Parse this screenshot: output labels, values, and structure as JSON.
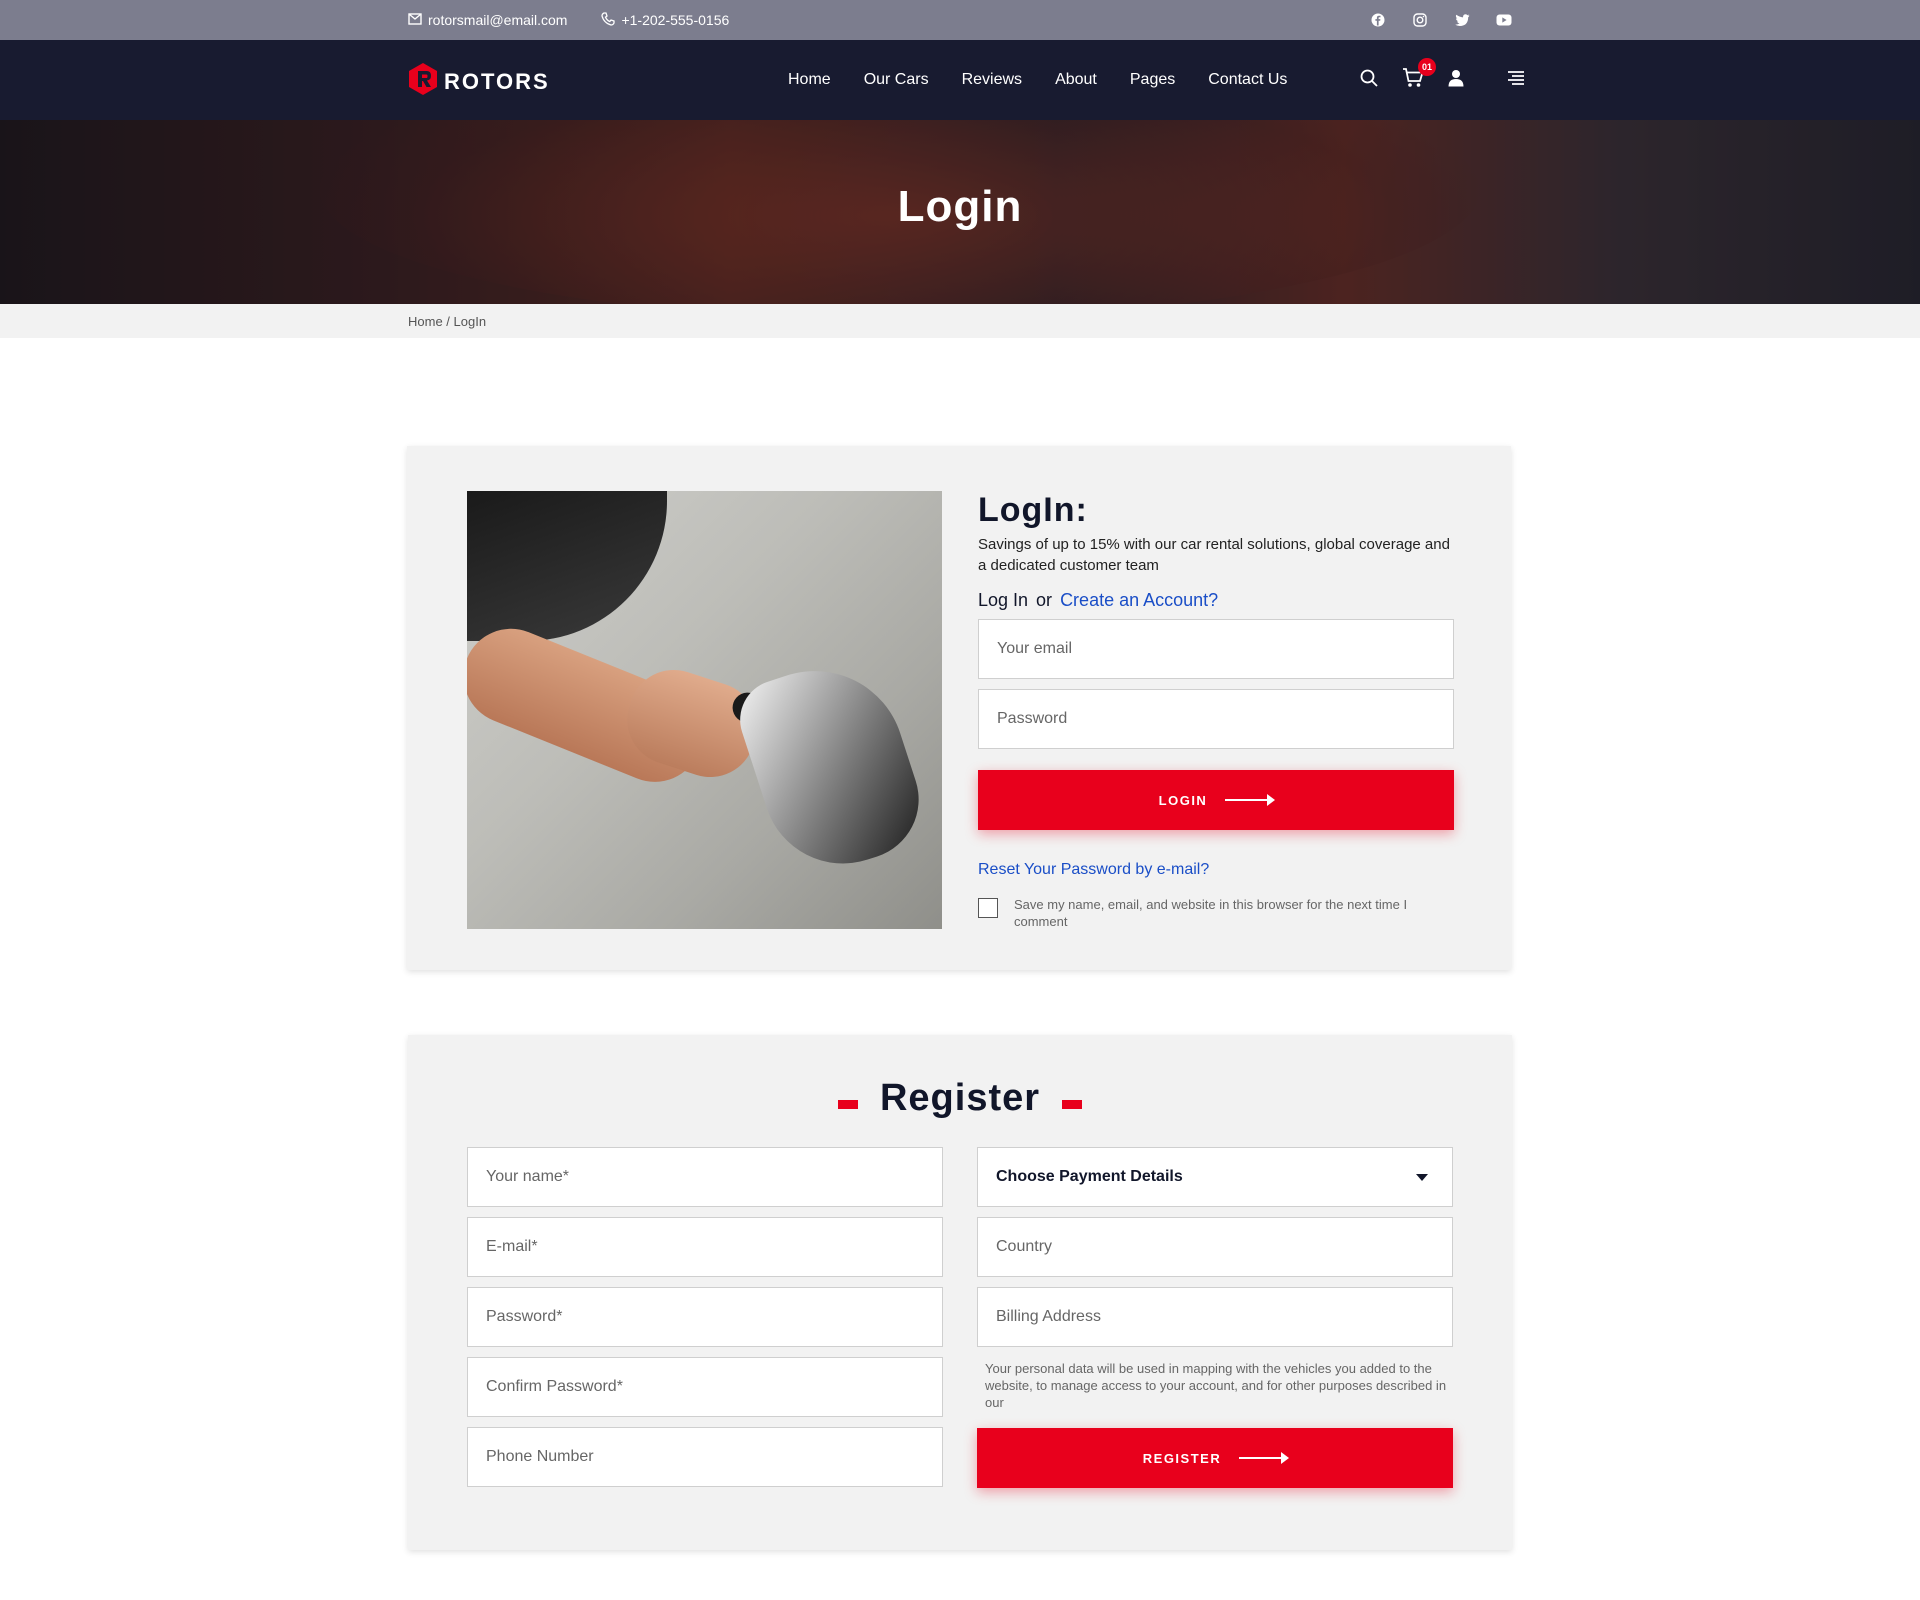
{
  "topbar": {
    "email": "rotorsmail@email.com",
    "phone": "+1-202-555-0156",
    "social": [
      "facebook-icon",
      "instagram-icon",
      "twitter-icon",
      "youtube-icon"
    ]
  },
  "header": {
    "logo_text": "ROTORS",
    "nav": [
      "Home",
      "Our Cars",
      "Reviews",
      "About",
      "Pages",
      "Contact Us"
    ],
    "cart_count": "01"
  },
  "hero": {
    "title": "Login"
  },
  "breadcrumb": "Home / LogIn",
  "login": {
    "title": "LogIn:",
    "description": "Savings of up to 15% with our car rental solutions, global coverage and a dedicated customer team",
    "or_prefix": "Log In",
    "or_word": "or",
    "create_link": "Create an Account?",
    "email_placeholder": "Your email",
    "password_placeholder": "Password",
    "button": "LOGIN",
    "reset_link": "Reset Your Password by e-mail?",
    "remember_text": "Save my name, email, and website in this browser for the next time I comment"
  },
  "register": {
    "title": "Register",
    "name_placeholder": "Your name*",
    "email_placeholder": "E-mail*",
    "password_placeholder": "Password*",
    "confirm_placeholder": "Confirm Password*",
    "phone_placeholder": "Phone Number",
    "payment_select": "Choose Payment Details",
    "country_placeholder": "Country",
    "billing_placeholder": "Billing Address",
    "privacy_text": "Your personal data will be used in mapping with the vehicles you added to the website, to manage access to your account, and for other purposes described in our",
    "button": "REGISTER"
  },
  "colors": {
    "accent": "#e8001c",
    "header": "#181b30",
    "topbar": "#7c7d8e",
    "link": "#1a4ec7"
  }
}
